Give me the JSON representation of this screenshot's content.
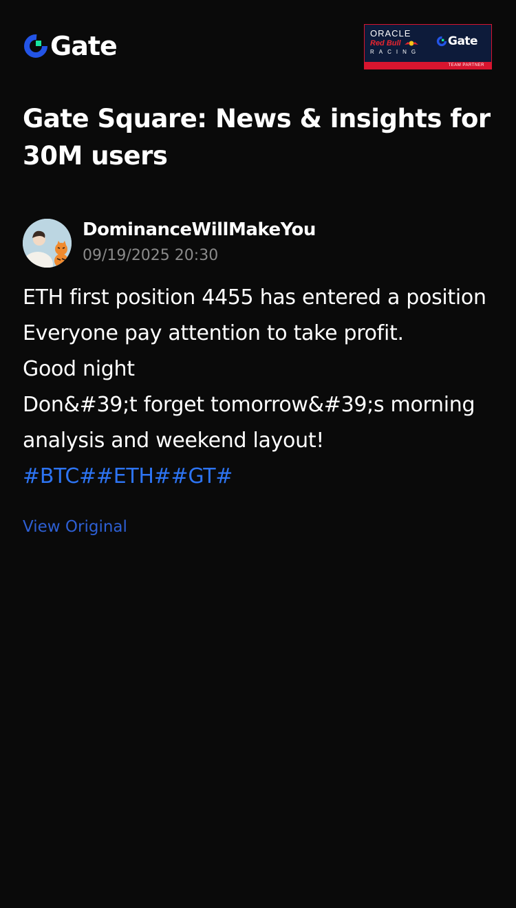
{
  "header": {
    "logo_text": "Gate",
    "logo_icon": "gate-logo-icon",
    "partner_banner": {
      "oracle": "ORACLE",
      "redbull": "Red Bull",
      "racing": "RACING",
      "gate": "Gate",
      "team_partner": "TEAM PARTNER"
    }
  },
  "page": {
    "title": "Gate Square: News & insights for 30M users"
  },
  "post": {
    "author": "DominanceWillMakeYou",
    "timestamp": "09/19/2025 20:30",
    "lines": [
      "ETH first position 4455 has entered a position",
      "Everyone pay attention to take profit.",
      "Good night",
      "Don&#39;t forget tomorrow&#39;s morning",
      "analysis and weekend layout!"
    ],
    "hashtags": "#BTC##ETH##GT#",
    "view_original": "View Original"
  },
  "colors": {
    "background": "#0a0a0a",
    "text": "#ffffff",
    "muted": "#8a8a8a",
    "link": "#2d74f3",
    "brand_blue": "#2354e6",
    "brand_green": "#17e5a0"
  }
}
